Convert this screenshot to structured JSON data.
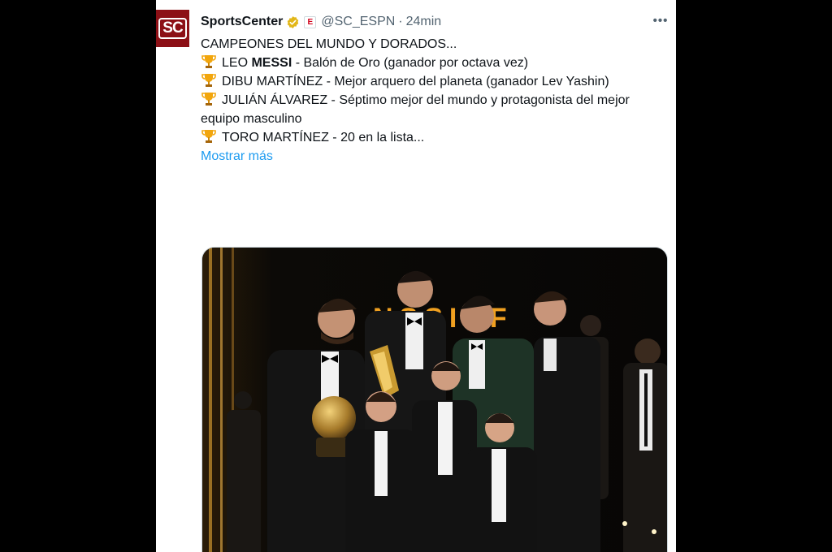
{
  "tweet": {
    "avatar_text": "SC",
    "display_name": "SportsCenter",
    "affiliate_badge": "E",
    "handle": "@SC_ESPN",
    "separator": "·",
    "time": "24min",
    "more_icon": "more-horizontal-icon",
    "lines": {
      "intro": "CAMPEONES DEL MUNDO Y DORADOS...",
      "messi_a": "LEO ",
      "messi_b": "MESSI",
      "messi_c": " - Balón de Oro (ganador por octava vez)",
      "dibu": "DIBU MARTÍNEZ - Mejor arquero del planeta (ganador Lev Yashin)",
      "julian": "JULIÁN ÁLVAREZ - Séptimo mejor del mundo y protagonista del mejor equipo masculino",
      "toro": "TORO MARTÍNEZ - 20 en la lista..."
    },
    "show_more": "Mostrar más",
    "photo_backdrop_text": "NSSINF"
  },
  "colors": {
    "link": "#1d9bf0",
    "text": "#0f1419",
    "secondary": "#536471",
    "avatar_bg": "#8c1016",
    "verified": "#e2b719",
    "trophy": "#f2a60d"
  }
}
